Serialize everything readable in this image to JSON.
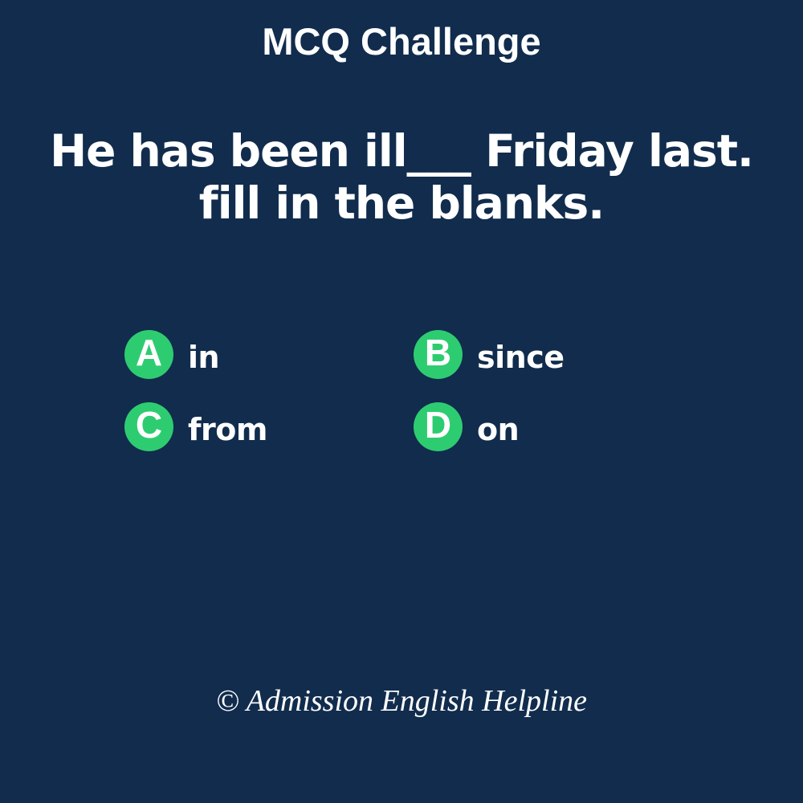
{
  "header": {
    "title": "MCQ Challenge"
  },
  "question": {
    "line1": "He has been ill___ Friday last.",
    "line2": "fill in the blanks."
  },
  "options": [
    {
      "letter": "A",
      "text": "in"
    },
    {
      "letter": "B",
      "text": "since"
    },
    {
      "letter": "C",
      "text": "from"
    },
    {
      "letter": "D",
      "text": "on"
    }
  ],
  "footer": {
    "credit": "© Admission English Helpline"
  },
  "colors": {
    "background": "#112c4d",
    "badge": "#2ecc71",
    "text": "#ffffff"
  }
}
